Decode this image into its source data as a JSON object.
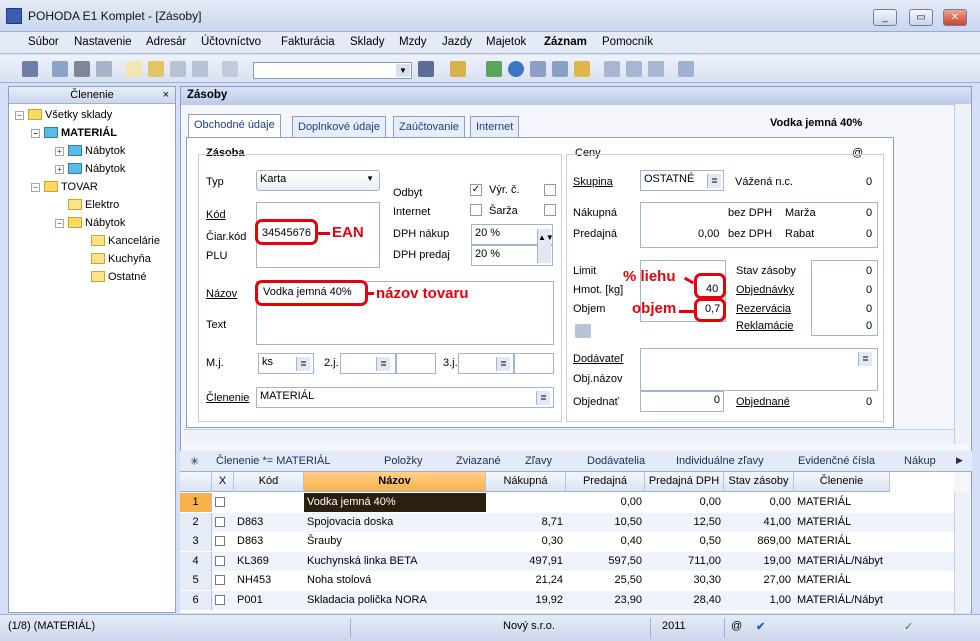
{
  "window": {
    "title": "POHODA E1 Komplet - [Zásoby]",
    "min": "_",
    "restore": "▭",
    "close": "✕"
  },
  "menu": [
    "Súbor",
    "Nastavenie",
    "Adresár",
    "Účtovníctvo",
    "Fakturácia",
    "Sklady",
    "Mzdy",
    "Jazdy",
    "Majetok",
    "Záznam",
    "Pomocník"
  ],
  "sidebar": {
    "header": "Členenie",
    "close": "×",
    "items": [
      {
        "label": "Všetky sklady"
      },
      {
        "label": "MATERIÁL"
      },
      {
        "label": "Nábytok"
      },
      {
        "label": "Nábytok"
      },
      {
        "label": "TOVAR"
      },
      {
        "label": "Elektro"
      },
      {
        "label": "Nábytok"
      },
      {
        "label": "Kancelárie"
      },
      {
        "label": "Kuchyňa"
      },
      {
        "label": "Ostatné"
      }
    ]
  },
  "main": {
    "title": "Zásoby",
    "item_name": "Vodka jemná 40%",
    "tabs": [
      "Obchodné údaje",
      "Doplnkové údaje",
      "Zaúčtovanie",
      "Internet"
    ],
    "zasoba": {
      "section": "Zásoba",
      "typ_label": "Typ",
      "typ_value": "Karta",
      "kod_label": "Kód",
      "ciarkod_label": "Čiar.kód",
      "ciarkod_value": "34545676",
      "plu_label": "PLU",
      "nazov_label": "Názov",
      "nazov_value": "Vodka jemná 40%",
      "text_label": "Text",
      "mj_label": "M.j.",
      "mj_value": "ks",
      "mj2_label": "2.j.",
      "mj3_label": "3.j.",
      "clenenie_label": "Členenie",
      "clenenie_value": "MATERIÁL",
      "odbyt_label": "Odbyt",
      "vyrc_label": "Výr. č.",
      "internet_label": "Internet",
      "sarza_label": "Šarža",
      "dph_nakup_label": "DPH nákup",
      "dph_nakup_value": "20 %",
      "dph_predaj_label": "DPH predaj",
      "dph_predaj_value": "20 %"
    },
    "ceny": {
      "section": "Ceny",
      "at": "@",
      "skupina_label": "Skupina",
      "skupina_value": "OSTATNÉ",
      "vazena_label": "Vážená n.c.",
      "vazena_value": "0",
      "nakupna_label": "Nákupná",
      "bezdph1": "bez DPH",
      "marza_label": "Marža",
      "marza_value": "0",
      "predajna_label": "Predajná",
      "predajna_value": "0,00",
      "bezdph2": "bez DPH",
      "rabat_label": "Rabat",
      "rabat_value": "0",
      "limit_label": "Limit",
      "hmot_label": "Hmot. [kg]",
      "hmot_value": "40",
      "objem_label": "Objem",
      "objem_value": "0,7",
      "stav_label": "Stav zásoby",
      "stav_value": "0",
      "objednavky_label": "Objednávky",
      "objednavky_value": "0",
      "rezervacia_label": "Rezervácia",
      "rezervacia_value": "0",
      "reklamacie_label": "Reklamácie",
      "reklamacie_value": "0",
      "dodavatel_label": "Dodávateľ",
      "objnazov_label": "Obj.názov",
      "objednat_label": "Objednať",
      "objednat_value": "0",
      "objednane_label": "Objednané",
      "objednane_value": "0"
    },
    "annotations": {
      "ean": "EAN",
      "nazov": "názov tovaru",
      "liehu": "% liehu",
      "objem": "objem"
    }
  },
  "bottom_tabs": [
    "✳",
    "Členenie *= MATERIÁL",
    "Položky",
    "Zviazané",
    "Zľavy",
    "Dodávatelia",
    "Individuálne zľavy",
    "Evidenčné čísla",
    "Nákup"
  ],
  "table": {
    "headers": [
      "X",
      "Kód",
      "Názov",
      "Nákupná",
      "Predajná",
      "Predajná DPH",
      "Stav zásoby",
      "Členenie"
    ],
    "rows": [
      {
        "n": "1",
        "kod": "",
        "nazov": "Vodka jemná 40%",
        "nakupna": "",
        "predajna": "0,00",
        "predajna_dph": "0,00",
        "stav": "0,00",
        "clenenie": "MATERIÁL"
      },
      {
        "n": "2",
        "kod": "D863",
        "nazov": "Spojovacia doska",
        "nakupna": "8,71",
        "predajna": "10,50",
        "predajna_dph": "12,50",
        "stav": "41,00",
        "clenenie": "MATERIÁL"
      },
      {
        "n": "3",
        "kod": "D863",
        "nazov": "Šrauby",
        "nakupna": "0,30",
        "predajna": "0,40",
        "predajna_dph": "0,50",
        "stav": "869,00",
        "clenenie": "MATERIÁL"
      },
      {
        "n": "4",
        "kod": "KL369",
        "nazov": "Kuchynská linka BETA",
        "nakupna": "497,91",
        "predajna": "597,50",
        "predajna_dph": "711,00",
        "stav": "19,00",
        "clenenie": "MATERIÁL/Nábyt"
      },
      {
        "n": "5",
        "kod": "NH453",
        "nazov": "Noha stolová",
        "nakupna": "21,24",
        "predajna": "25,50",
        "predajna_dph": "30,30",
        "stav": "27,00",
        "clenenie": "MATERIÁL"
      },
      {
        "n": "6",
        "kod": "P001",
        "nazov": "Skladacia polička NORA",
        "nakupna": "19,92",
        "predajna": "23,90",
        "predajna_dph": "28,40",
        "stav": "1,00",
        "clenenie": "MATERIÁL/Nábyt"
      }
    ]
  },
  "status": {
    "record": "(1/8) (MATERIÁL)",
    "company": "Nový s.r.o.",
    "year": "2011",
    "at": "@"
  }
}
